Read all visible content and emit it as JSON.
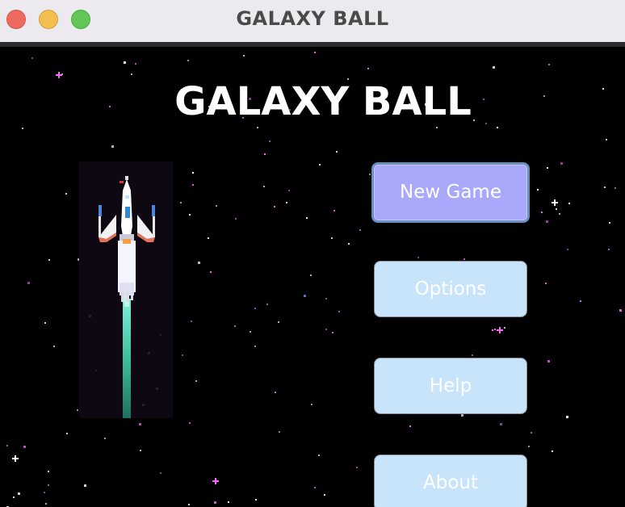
{
  "window": {
    "title": "GALAXY BALL",
    "controls": [
      "close",
      "minimize",
      "maximize"
    ]
  },
  "game": {
    "title": "GALAXY BALL",
    "ship_icon": "spaceship-icon"
  },
  "menu": {
    "items": [
      {
        "label": "New Game",
        "selected": true
      },
      {
        "label": "Options",
        "selected": false
      },
      {
        "label": "Help",
        "selected": false
      },
      {
        "label": "About",
        "selected": false
      }
    ]
  },
  "colors": {
    "background": "#000000",
    "button": "#c7e4fb",
    "button_selected": "#a9a8fb",
    "selected_border": "#6b8fc0",
    "star_pink": "#ff66ff",
    "star_white": "#ffffff"
  }
}
